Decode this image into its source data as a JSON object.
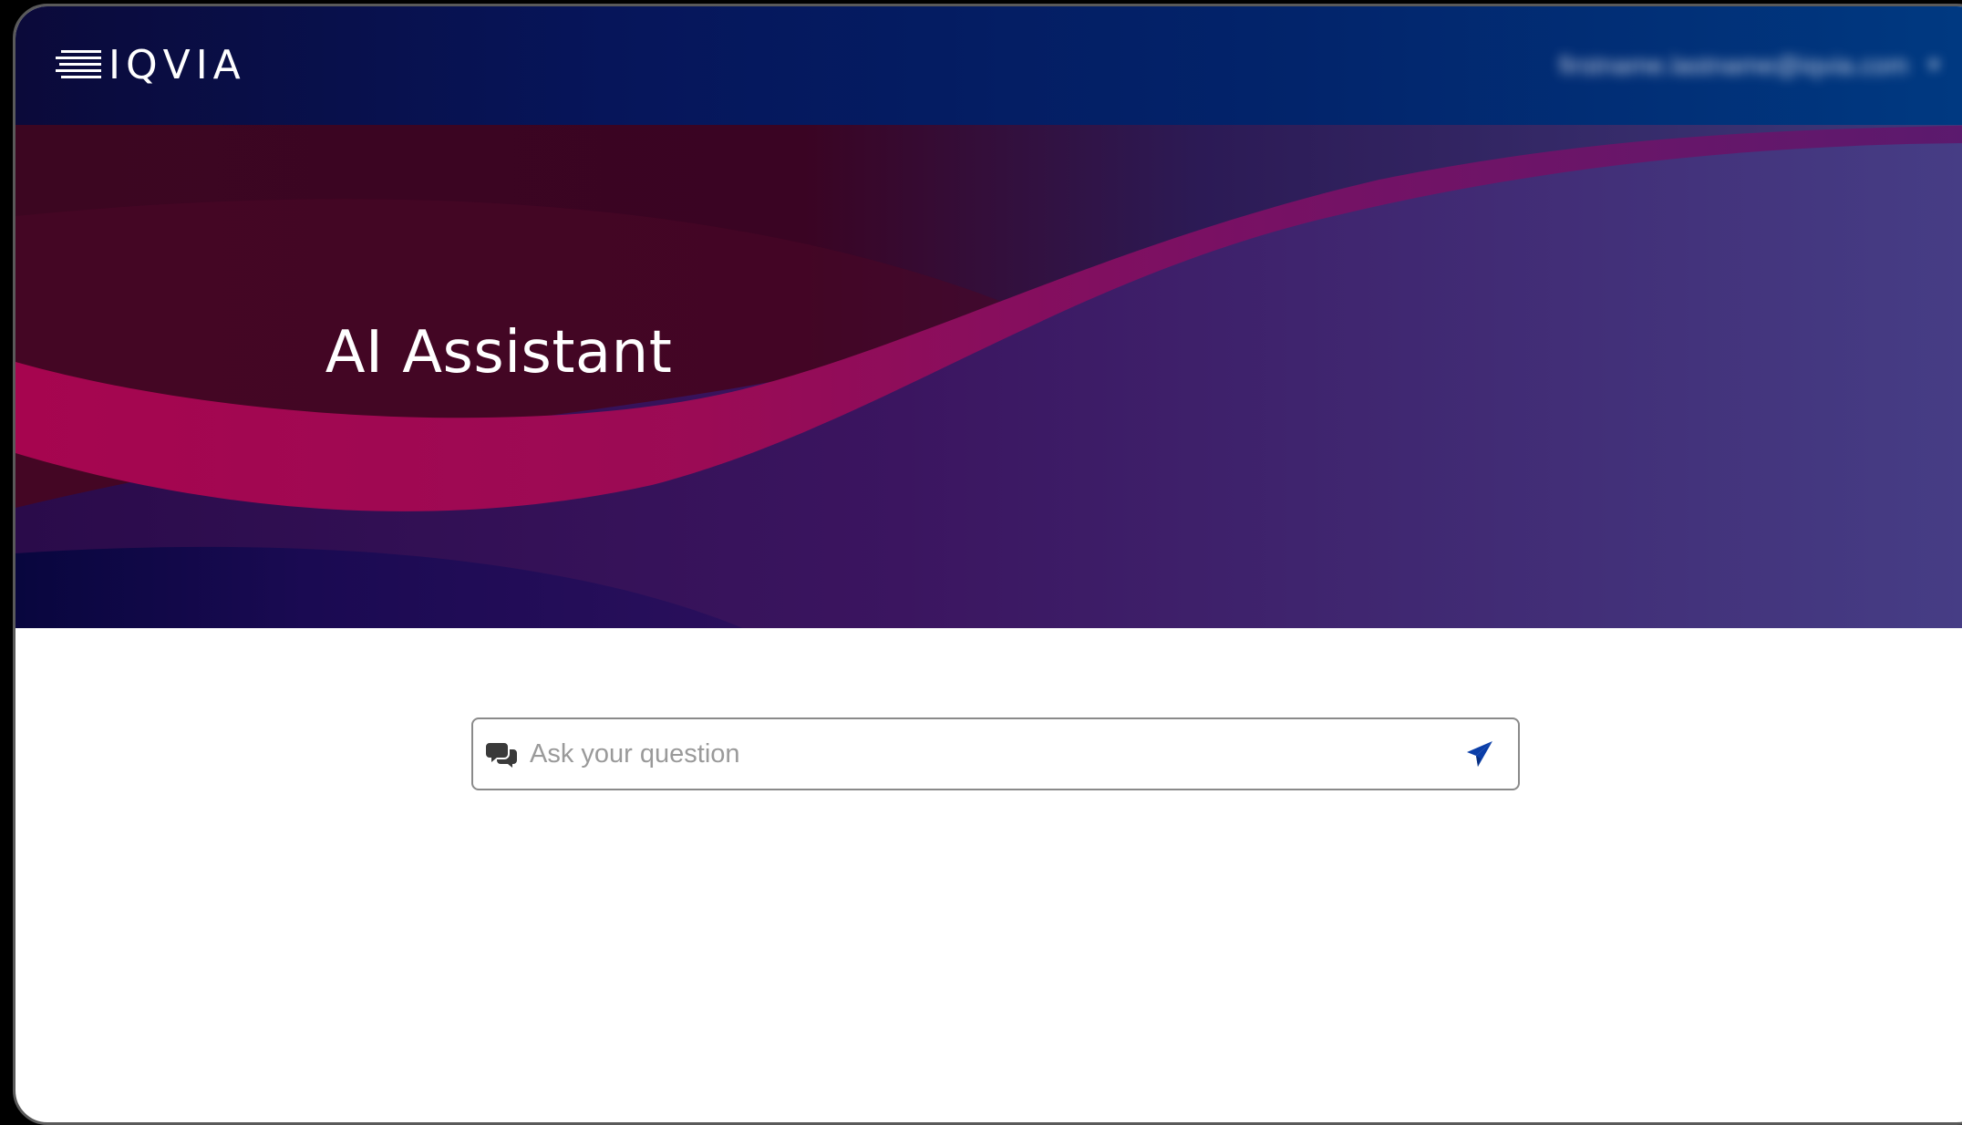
{
  "navbar": {
    "logo_text": "IQVIA",
    "user_email": "firstname.lastname@iqvia.com",
    "user_menu_icon": "chevron-down-icon"
  },
  "hero": {
    "title": "AI Assistant"
  },
  "search": {
    "placeholder": "Ask your question",
    "value": "",
    "leading_icon": "chat-bubbles-icon",
    "submit_icon": "send-icon"
  },
  "colors": {
    "navbar_start": "#0b0a3a",
    "navbar_end": "#003a82",
    "hero_magenta": "#a3064f",
    "hero_purple": "#3a1f6e",
    "send_icon": "#0b3ea8"
  }
}
